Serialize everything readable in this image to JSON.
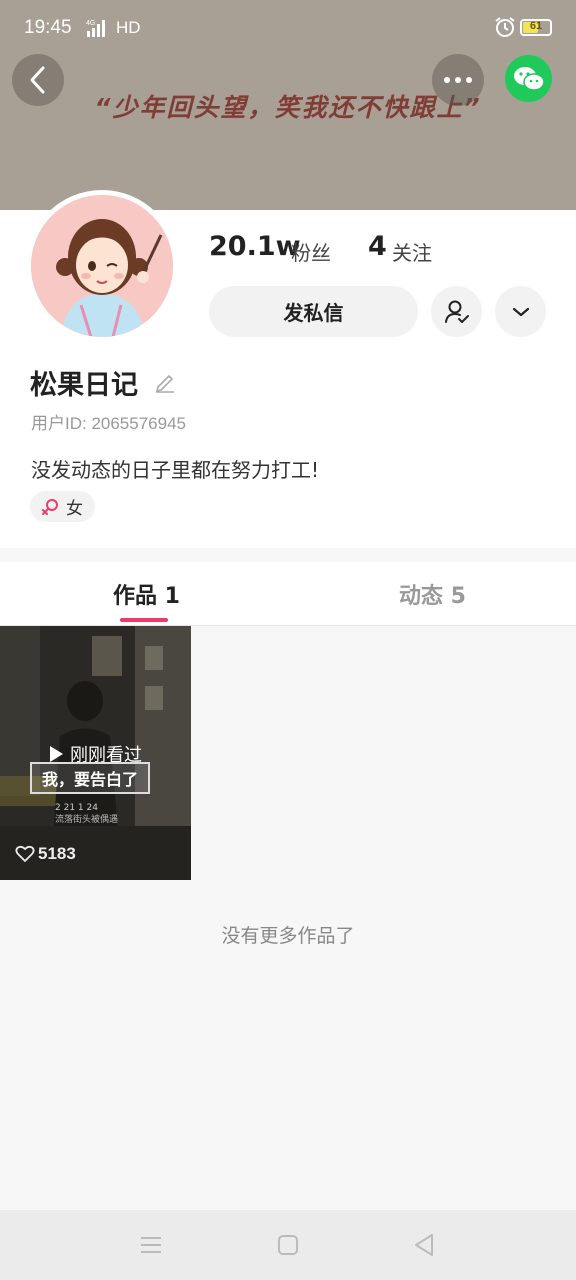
{
  "status_bar": {
    "time": "19:45",
    "network": "4G",
    "hd": "HD",
    "battery": "61",
    "battery_level_percent": 61
  },
  "banner": {
    "quote": "“少年回头望，笑我还不快跟上”",
    "background_color": "#a8a095"
  },
  "profile": {
    "followers_count": "20.1w",
    "followers_label": "粉丝",
    "following_count": "4",
    "following_label": "关注",
    "message_button": "发私信",
    "username": "松果日记",
    "user_id": "用户ID: 2065576945",
    "bio": "没发动态的日子里都在努力打工!",
    "gender": "女"
  },
  "tabs": [
    {
      "label": "作品 1",
      "active": true
    },
    {
      "label": "动态 5",
      "active": false
    }
  ],
  "video": {
    "watched_label": "刚刚看过",
    "caption": "我，要告白了",
    "likes": "5183"
  },
  "footer": {
    "no_more": "没有更多作品了"
  },
  "icons": {
    "back": "back-icon",
    "more": "more-icon",
    "wechat": "wechat-icon",
    "follow_status": "follow-status-icon",
    "expand": "chevron-down-icon",
    "edit": "edit-icon",
    "female": "female-icon",
    "play": "play-icon",
    "heart": "heart-icon"
  },
  "colors": {
    "accent": "#ee3b6a",
    "wechat": "#1fc95a"
  }
}
